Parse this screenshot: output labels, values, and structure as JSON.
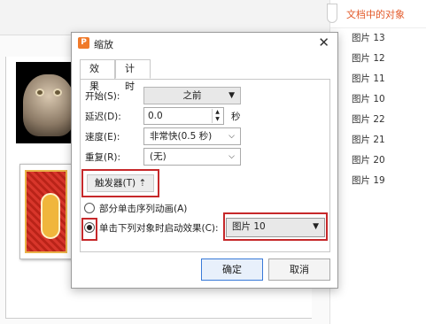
{
  "panel": {
    "title": "文档中的对象",
    "items": [
      "图片 13",
      "图片 12",
      "图片 11",
      "图片 10",
      "图片 22",
      "图片 21",
      "图片 20",
      "图片 19"
    ]
  },
  "dialog": {
    "app_icon": "wps-presentation-icon",
    "title": "缩放",
    "close": "✕",
    "tabs": [
      "效果",
      "计时"
    ],
    "start": {
      "label": "开始(S):",
      "value": "之前"
    },
    "delay": {
      "label": "延迟(D):",
      "value": "0.0",
      "unit": "秒"
    },
    "speed": {
      "label": "速度(E):",
      "value": "非常快(0.5 秒)"
    },
    "repeat": {
      "label": "重复(R):",
      "value": "(无)"
    },
    "trigger_button": "触发器(T) ⇡",
    "radio_sequence": "部分单击序列动画(A)",
    "radio_object": "单击下列对象时启动效果(C):",
    "object_value": "图片 10",
    "ok": "确定",
    "cancel": "取消"
  },
  "colors": {
    "accent_red": "#c6282a",
    "panel_title": "#e35a2a"
  }
}
